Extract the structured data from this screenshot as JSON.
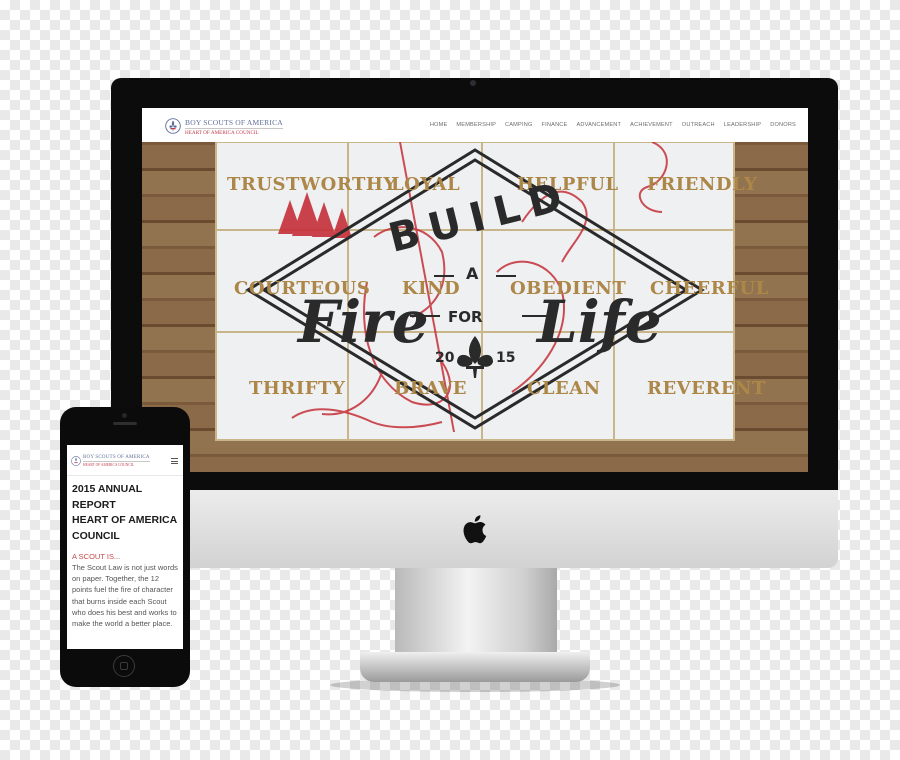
{
  "desktop": {
    "brand": {
      "name": "BOY SCOUTS OF AMERICA",
      "council": "HEART OF AMERICA COUNCIL"
    },
    "nav": [
      "HOME",
      "MEMBERSHIP",
      "CAMPING",
      "FINANCE",
      "ADVANCEMENT",
      "ACHIEVEMENT",
      "OUTREACH",
      "LEADERSHIP",
      "DONORS"
    ],
    "hero": {
      "scout_law_top": [
        "TRUSTWORTHY",
        "LOYAL",
        "HELPFUL",
        "FRIENDLY"
      ],
      "scout_law_middle": [
        "COURTEOUS",
        "KIND",
        "OBEDIENT",
        "CHEERFUL"
      ],
      "scout_law_bottom": [
        "THRIFTY",
        "BRAVE",
        "CLEAN",
        "REVERENT"
      ],
      "build": "BUILD",
      "a": "A",
      "fire": "Fire",
      "for": "FOR",
      "life": "Life",
      "year_left": "20",
      "year_right": "15"
    }
  },
  "phone": {
    "brand": {
      "name": "BOY SCOUTS OF AMERICA",
      "council": "HEART OF AMERICA COUNCIL"
    },
    "title_lines": [
      "2015 ANNUAL",
      "REPORT",
      "HEART OF AMERICA",
      "COUNCIL"
    ],
    "subheading": "A SCOUT IS...",
    "body": "The Scout Law is not just words on paper. Together, the 12 points fuel the fire of character that burns inside each Scout who does his best and works to make the world a better place."
  },
  "colors": {
    "brand_blue": "#5f6f98",
    "brand_red": "#c23b4a",
    "gold": "#ad8748",
    "wood": "#7a5a3b"
  },
  "icons": [
    "fleur-de-lis-icon",
    "apple-logo-icon",
    "hamburger-menu-icon"
  ]
}
